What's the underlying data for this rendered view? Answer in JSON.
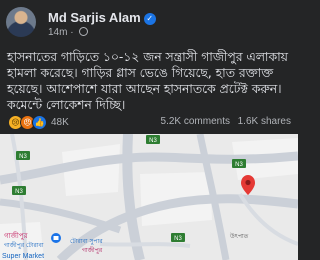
{
  "post": {
    "author": "Md Sarjis Alam",
    "time": "14m",
    "text": "হাসনাতের গাড়িতে ১০-১২ জন সন্ত্রাসী গাজীপুর এলাকায় হামলা করেছে। গাড়ির গ্লাস ভেঙে গিয়েছে, হাত রক্তাক্ত হয়েছে। আশেপাশে যারা আছেন হাসনাতকে প্রটেক্ট করুন। কমেন্টে লোকেশন দিচ্ছি।"
  },
  "stats": {
    "reactions": [
      "sad",
      "angry",
      "like"
    ],
    "reaction_count": "48K",
    "comments": "5.2K comments",
    "shares": "1.6K shares"
  },
  "map": {
    "road_labels": [
      "N3",
      "N3",
      "N3",
      "N3",
      "N3"
    ],
    "place_labels": [
      "গাজীপুর",
      "গাজীপুর টোরাবা",
      "Super Market",
      "গাজীপুর",
      "টোরাবা সুপার",
      "উৎপাত"
    ],
    "colors": {
      "background": "#eaeaea",
      "road": "#cbd0d8",
      "block": "#f3f3f3",
      "pin": "#e53935",
      "shield": "#2e7d32"
    }
  }
}
